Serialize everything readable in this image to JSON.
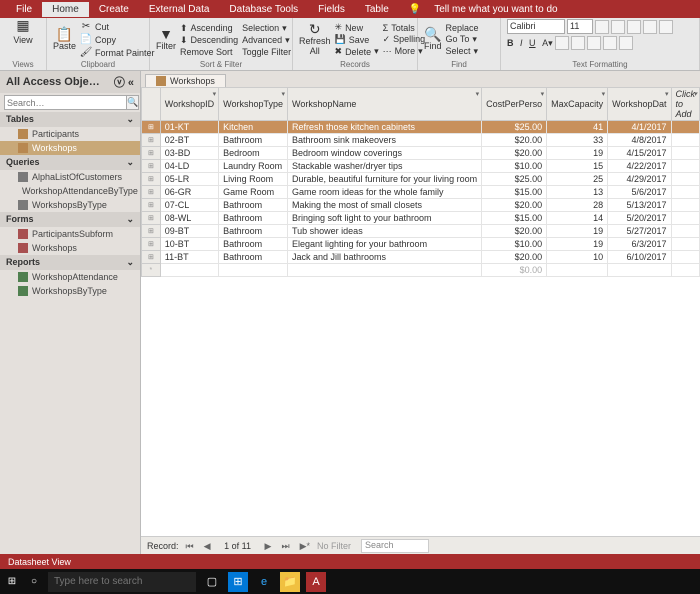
{
  "menu_tabs": [
    "File",
    "Home",
    "Create",
    "External Data",
    "Database Tools",
    "Fields",
    "Table"
  ],
  "menu_active": "Home",
  "tell_me": "Tell me what you want to do",
  "ribbon": {
    "views": {
      "label": "Views",
      "view": "View"
    },
    "clipboard": {
      "label": "Clipboard",
      "paste": "Paste",
      "cut": "Cut",
      "copy": "Copy",
      "fmt": "Format Painter"
    },
    "sort": {
      "label": "Sort & Filter",
      "filter": "Filter",
      "asc": "Ascending",
      "desc": "Descending",
      "rem": "Remove Sort",
      "sel": "Selection",
      "adv": "Advanced",
      "tog": "Toggle Filter"
    },
    "records": {
      "label": "Records",
      "refresh": "Refresh All",
      "new": "New",
      "save": "Save",
      "del": "Delete",
      "tot": "Totals",
      "spell": "Spelling",
      "more": "More"
    },
    "find": {
      "label": "Find",
      "find": "Find",
      "repl": "Replace",
      "goto": "Go To",
      "sel": "Select"
    },
    "format": {
      "label": "Text Formatting",
      "font": "Calibri",
      "size": "11"
    }
  },
  "nav": {
    "title": "All Access Obje…",
    "search_ph": "Search…",
    "groups": [
      {
        "label": "Tables",
        "items": [
          {
            "name": "Participants",
            "icon": "t"
          },
          {
            "name": "Workshops",
            "icon": "t",
            "sel": true
          }
        ]
      },
      {
        "label": "Queries",
        "items": [
          {
            "name": "AlphaListOfCustomers",
            "icon": "q"
          },
          {
            "name": "WorkshopAttendanceByType",
            "icon": "q"
          },
          {
            "name": "WorkshopsByType",
            "icon": "q"
          }
        ]
      },
      {
        "label": "Forms",
        "items": [
          {
            "name": "ParticipantsSubform",
            "icon": "f"
          },
          {
            "name": "Workshops",
            "icon": "f"
          }
        ]
      },
      {
        "label": "Reports",
        "items": [
          {
            "name": "WorkshopAttendance",
            "icon": "r"
          },
          {
            "name": "WorkshopsByType",
            "icon": "r"
          }
        ]
      }
    ]
  },
  "tab_title": "Workshops",
  "columns": [
    "WorkshopID",
    "WorkshopType",
    "WorkshopName",
    "CostPerPerso",
    "MaxCapacity",
    "WorkshopDat",
    "Click to Add"
  ],
  "rows": [
    {
      "id": "01-KT",
      "type": "Kitchen",
      "name": "Refresh those kitchen cabinets",
      "cost": "$25.00",
      "cap": "41",
      "date": "4/1/2017",
      "sel": true
    },
    {
      "id": "02-BT",
      "type": "Bathroom",
      "name": "Bathroom sink makeovers",
      "cost": "$20.00",
      "cap": "33",
      "date": "4/8/2017"
    },
    {
      "id": "03-BD",
      "type": "Bedroom",
      "name": "Bedroom window coverings",
      "cost": "$20.00",
      "cap": "19",
      "date": "4/15/2017"
    },
    {
      "id": "04-LD",
      "type": "Laundry Room",
      "name": "Stackable washer/dryer tips",
      "cost": "$10.00",
      "cap": "15",
      "date": "4/22/2017"
    },
    {
      "id": "05-LR",
      "type": "Living Room",
      "name": "Durable, beautiful furniture for your living room",
      "cost": "$25.00",
      "cap": "25",
      "date": "4/29/2017"
    },
    {
      "id": "06-GR",
      "type": "Game Room",
      "name": "Game room ideas for the whole family",
      "cost": "$15.00",
      "cap": "13",
      "date": "5/6/2017"
    },
    {
      "id": "07-CL",
      "type": "Bathroom",
      "name": "Making the most of small closets",
      "cost": "$20.00",
      "cap": "28",
      "date": "5/13/2017"
    },
    {
      "id": "08-WL",
      "type": "Bathroom",
      "name": "Bringing soft light to your bathroom",
      "cost": "$15.00",
      "cap": "14",
      "date": "5/20/2017"
    },
    {
      "id": "09-BT",
      "type": "Bathroom",
      "name": "Tub shower ideas",
      "cost": "$20.00",
      "cap": "19",
      "date": "5/27/2017"
    },
    {
      "id": "10-BT",
      "type": "Bathroom",
      "name": "Elegant lighting for your bathroom",
      "cost": "$10.00",
      "cap": "19",
      "date": "6/3/2017"
    },
    {
      "id": "11-BT",
      "type": "Bathroom",
      "name": "Jack and Jill bathrooms",
      "cost": "$20.00",
      "cap": "10",
      "date": "6/10/2017"
    }
  ],
  "star_cost": "$0.00",
  "recnav": {
    "label": "Record:",
    "pos": "1 of 11",
    "nofilter": "No Filter",
    "search": "Search"
  },
  "status": "Datasheet View",
  "taskbar_search": "Type here to search"
}
